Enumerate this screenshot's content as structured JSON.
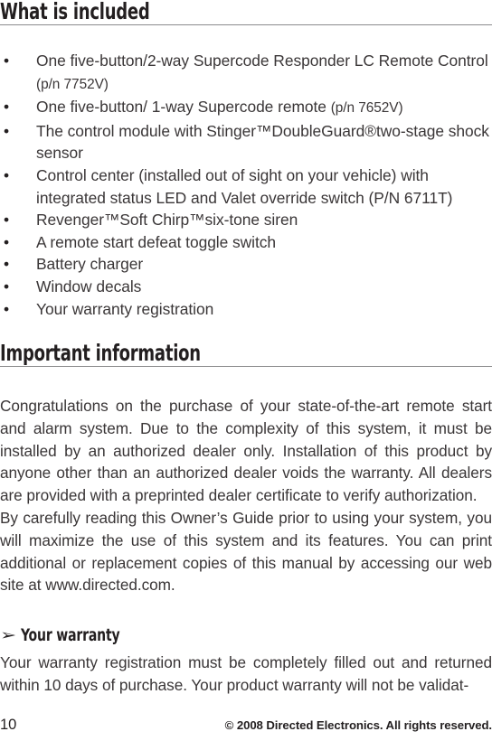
{
  "document": {
    "sections": [
      {
        "heading": "What is included",
        "items": [
          {
            "text": "One five-button/2-way Supercode Responder LC Remote Control ",
            "suffix_small": "(p/n 7752V)"
          },
          {
            "text": "One five-button/ 1-way Supercode remote ",
            "suffix_small": "(p/n 7652V)"
          },
          {
            "text": "The control module with Stinger™DoubleGuard®two-stage shock sensor",
            "suffix_small": ""
          },
          {
            "text": "Control center (installed out of sight on your vehicle) with integrated status LED and Valet override switch (P/N 6711T)",
            "suffix_small": ""
          },
          {
            "text": "Revenger™Soft Chirp™six-tone siren",
            "suffix_small": ""
          },
          {
            "text": "A remote start defeat toggle switch",
            "suffix_small": ""
          },
          {
            "text": "Battery charger",
            "suffix_small": ""
          },
          {
            "text": "Window decals",
            "suffix_small": ""
          },
          {
            "text": "Your warranty registration",
            "suffix_small": ""
          }
        ]
      },
      {
        "heading": "Important information",
        "paragraph_1": "Congratulations on the purchase of your state-of-the-art remote start and alarm system. Due to the complexity of this system, it must be installed by an authorized dealer only. Installation of this product by anyone other than an authorized dealer voids the warranty. All dealers are provided with a preprinted dealer certificate to verify authorization.",
        "paragraph_2": "By carefully reading this Owner’s Guide prior to using your system, you will maximize the use of this system and its features. You can print additional or replacement copies of this manual by accessing our web site at www.directed.com.",
        "subsection": {
          "arrow_icon": "➢",
          "heading": "Your warranty",
          "paragraph": "Your warranty registration must be completely filled out and returned within 10 days of purchase. Your product warranty will not be validat-"
        }
      }
    ],
    "footer": {
      "page_number": "10",
      "copyright": "© 2008 Directed Electronics. All rights reserved."
    }
  }
}
